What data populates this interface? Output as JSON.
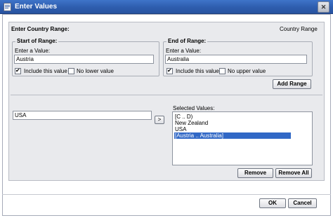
{
  "window": {
    "title": "Enter Values",
    "close_glyph": "✕"
  },
  "header": {
    "title": "Enter Country Range:",
    "right_label": "Country Range"
  },
  "start_range": {
    "legend": "Start of Range:",
    "prompt": "Enter a Value:",
    "value": "Austria",
    "include_label": "Include this value",
    "include_checked": true,
    "no_bound_label": "No lower value",
    "no_bound_checked": false
  },
  "end_range": {
    "legend": "End of Range:",
    "prompt": "Enter a Value:",
    "value": "Australia",
    "include_label": "Include this value",
    "include_checked": true,
    "no_bound_label": "No upper value",
    "no_bound_checked": false
  },
  "buttons": {
    "add_range": "Add Range",
    "move_right": ">",
    "remove": "Remove",
    "remove_all": "Remove All",
    "ok": "OK",
    "cancel": "Cancel"
  },
  "value_entry": {
    "value": "USA"
  },
  "selected_values": {
    "label": "Selected Values:",
    "items": [
      "[C .. D)",
      "New Zealand",
      "USA",
      "[Austria .. Australia]"
    ],
    "selected_index": 3
  },
  "colors": {
    "titlebar": "#2f5fb0",
    "panel": "#e9eaed",
    "selection": "#3168c6"
  },
  "icons": {
    "title_icon": "document-icon",
    "checkbox_check": "check-icon",
    "close": "close-icon"
  }
}
